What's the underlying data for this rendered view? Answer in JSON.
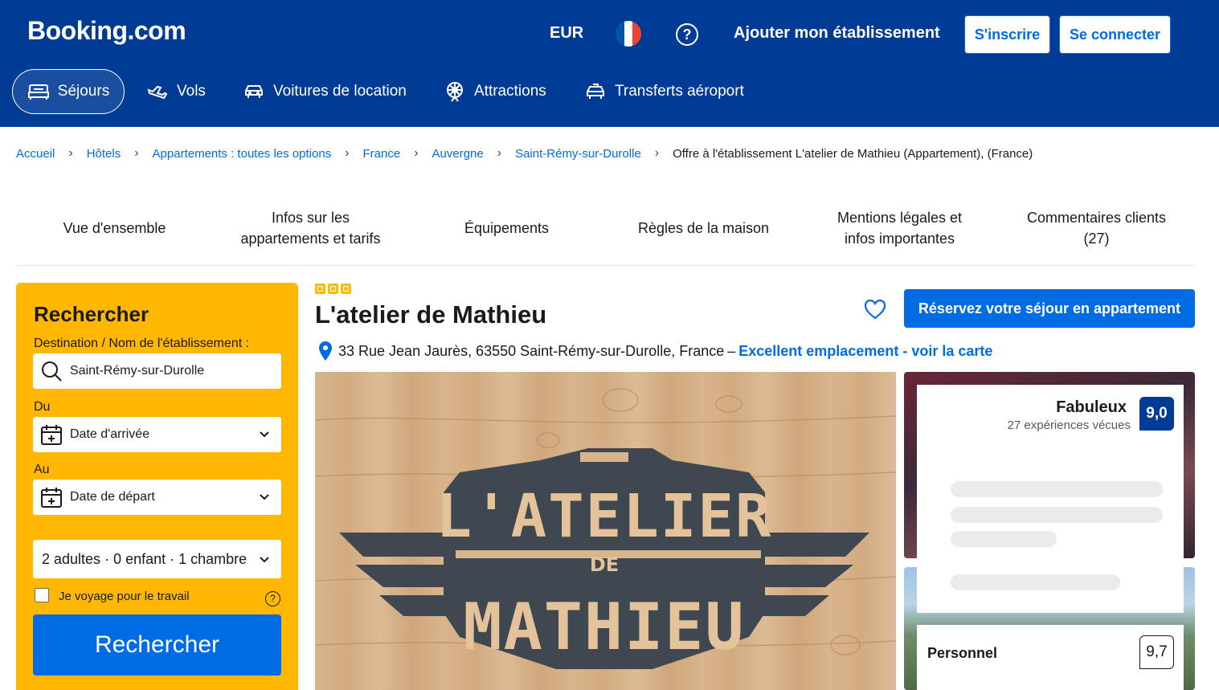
{
  "header": {
    "logo": "Booking.com",
    "currency": "EUR",
    "language_flag": "france-flag",
    "help_icon": "?",
    "add_property": "Ajouter mon établissement",
    "signup": "S'inscrire",
    "login": "Se connecter",
    "nav": [
      {
        "label": "Séjours",
        "icon": "bed-icon",
        "active": true
      },
      {
        "label": "Vols",
        "icon": "plane-icon",
        "active": false
      },
      {
        "label": "Voitures de location",
        "icon": "car-icon",
        "active": false
      },
      {
        "label": "Attractions",
        "icon": "attractions-icon",
        "active": false
      },
      {
        "label": "Transferts aéroport",
        "icon": "taxi-icon",
        "active": false
      }
    ]
  },
  "breadcrumb": {
    "items": [
      "Accueil",
      "Hôtels",
      "Appartements : toutes les options",
      "France",
      "Auvergne",
      "Saint-Rémy-sur-Durolle"
    ],
    "current": "Offre à l'établissement L'atelier de Mathieu (Appartement), (France)"
  },
  "tabs": [
    {
      "line1": "Vue d'ensemble",
      "line2": ""
    },
    {
      "line1": "Infos sur les",
      "line2": "appartements et tarifs"
    },
    {
      "line1": "Équipements",
      "line2": ""
    },
    {
      "line1": "Règles de la maison",
      "line2": ""
    },
    {
      "line1": "Mentions légales et",
      "line2": "infos importantes"
    },
    {
      "line1": "Commentaires clients",
      "line2": "(27)"
    }
  ],
  "search": {
    "title": "Rechercher",
    "destination_label": "Destination / Nom de l'établissement :",
    "destination_value": "Saint-Rémy-sur-Durolle",
    "from_label": "Du",
    "checkin_placeholder": "Date d'arrivée",
    "to_label": "Au",
    "checkout_placeholder": "Date de départ",
    "guests": "2 adultes · 0 enfant · 1 chambre",
    "work_travel": "Je voyage pour le travail",
    "button": "Rechercher"
  },
  "property": {
    "stars": 3,
    "name": "L'atelier de Mathieu",
    "reserve_button": "Réservez votre séjour en appartement",
    "address": "33 Rue Jean Jaurès, 63550 Saint-Rémy-sur-Durolle, France",
    "dash": "–",
    "location_link": "Excellent emplacement - voir la carte",
    "photo_text_top": "L'ATELIER",
    "photo_text_mid": "DE",
    "photo_text_bottom": "MATHIEU"
  },
  "review": {
    "score_word": "Fabuleux",
    "count_text": "27 expériences vécues",
    "score": "9,0",
    "staff_label": "Personnel",
    "staff_score": "9,7"
  },
  "colors": {
    "brand_blue": "#003b95",
    "action_blue": "#006ce4",
    "yellow": "#ffb700"
  }
}
